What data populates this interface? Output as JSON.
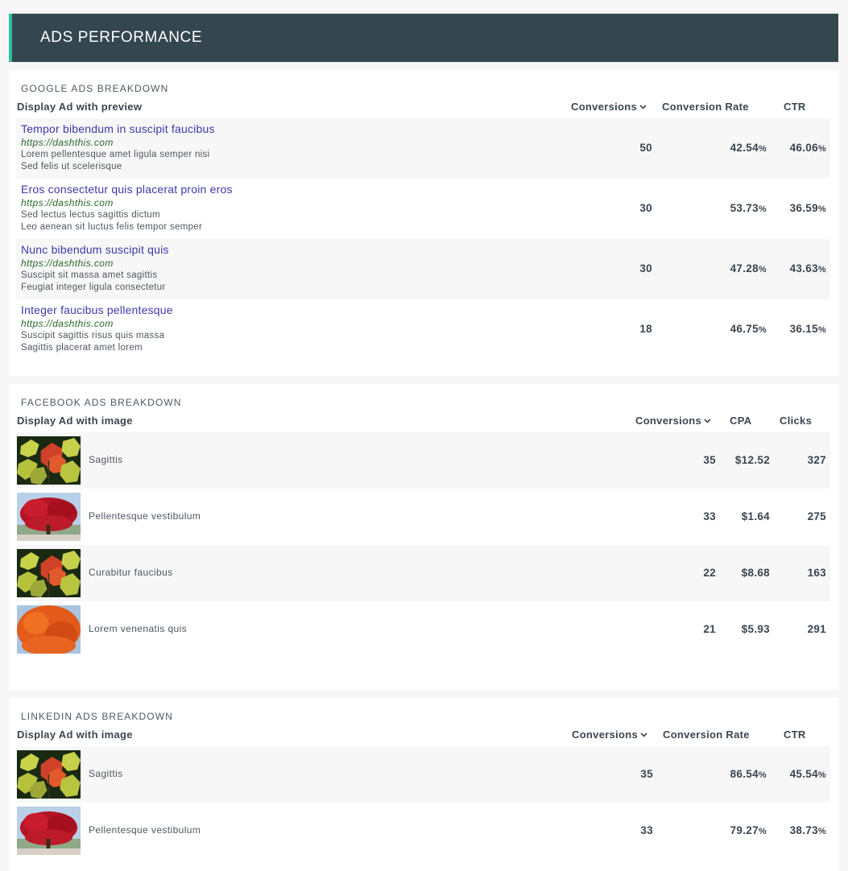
{
  "header": {
    "title": "ADS PERFORMANCE"
  },
  "google": {
    "title": "GOOGLE ADS BREAKDOWN",
    "columns": {
      "ad": "Display Ad with preview",
      "conversions": "Conversions",
      "rate": "Conversion Rate",
      "ctr": "CTR"
    },
    "rows": [
      {
        "title": "Tempor bibendum in suscipit faucibus",
        "url": "https://dashthis.com",
        "line1": "Lorem pellentesque amet ligula semper nisi",
        "line2": "Sed felis ut scelerisque",
        "conversions": "50",
        "rate": "42.54",
        "ctr": "46.06"
      },
      {
        "title": "Eros consectetur quis placerat proin eros",
        "url": "https://dashthis.com",
        "line1": "Sed lectus lectus sagittis dictum",
        "line2": "Leo aenean sit luctus felis tempor semper",
        "conversions": "30",
        "rate": "53.73",
        "ctr": "36.59"
      },
      {
        "title": "Nunc bibendum suscipit quis",
        "url": "https://dashthis.com",
        "line1": "Suscipit sit massa amet sagittis",
        "line2": "Feugiat integer ligula consectetur",
        "conversions": "30",
        "rate": "47.28",
        "ctr": "43.63"
      },
      {
        "title": "Integer faucibus pellentesque",
        "url": "https://dashthis.com",
        "line1": "Suscipit sagittis risus quis massa",
        "line2": "Sagittis placerat amet lorem",
        "conversions": "18",
        "rate": "46.75",
        "ctr": "36.15"
      }
    ]
  },
  "facebook": {
    "title": "FACEBOOK ADS BREAKDOWN",
    "columns": {
      "ad": "Display Ad with image",
      "conversions": "Conversions",
      "cpa": "CPA",
      "clicks": "Clicks"
    },
    "rows": [
      {
        "label": "Sagittis",
        "image": "leaves-image",
        "conversions": "35",
        "cpa": "$12.52",
        "clicks": "327"
      },
      {
        "label": "Pellentesque vestibulum",
        "image": "red-tree-image",
        "conversions": "33",
        "cpa": "$1.64",
        "clicks": "275"
      },
      {
        "label": "Curabitur faucibus",
        "image": "leaves-image",
        "conversions": "22",
        "cpa": "$8.68",
        "clicks": "163"
      },
      {
        "label": "Lorem venenatis quis",
        "image": "orange-tree-image",
        "conversions": "21",
        "cpa": "$5.93",
        "clicks": "291"
      }
    ]
  },
  "linkedin": {
    "title": "LINKEDIN ADS BREAKDOWN",
    "columns": {
      "ad": "Display Ad with image",
      "conversions": "Conversions",
      "rate": "Conversion Rate",
      "ctr": "CTR"
    },
    "rows": [
      {
        "label": "Sagittis",
        "image": "leaves-image",
        "conversions": "35",
        "rate": "86.54",
        "ctr": "45.54"
      },
      {
        "label": "Pellentesque vestibulum",
        "image": "red-tree-image",
        "conversions": "33",
        "rate": "79.27",
        "ctr": "38.73"
      }
    ]
  },
  "units": {
    "percent": "%"
  },
  "colors": {
    "header_bg": "#344650",
    "accent": "#2fbf9c",
    "link": "#3d3aa8",
    "url": "#2a6a2a"
  }
}
